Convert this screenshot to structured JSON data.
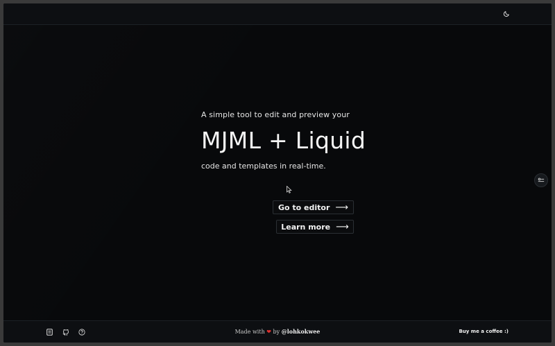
{
  "hero": {
    "subtitle": "A simple tool to edit and preview your",
    "headline": "MJML + Liquid",
    "caption": "code and templates in real-time."
  },
  "actions": {
    "editor_label": "Go to editor",
    "learn_label": "Learn more",
    "arrow": "⟶"
  },
  "footer": {
    "made_with": "Made with",
    "heart": "❤",
    "by": "by",
    "author": "@lohkokwee",
    "coffee": "Buy me a coffee :)",
    "icons": [
      "notes-icon",
      "github-icon",
      "help-icon"
    ]
  },
  "topbar": {
    "icon": "moon-icon"
  },
  "side": {
    "icon": "settings-toggle-icon"
  },
  "colors": {
    "background": "#08090b",
    "bar": "#0d0f12",
    "text": "#f5f5f5",
    "heart": "#e0312f"
  }
}
